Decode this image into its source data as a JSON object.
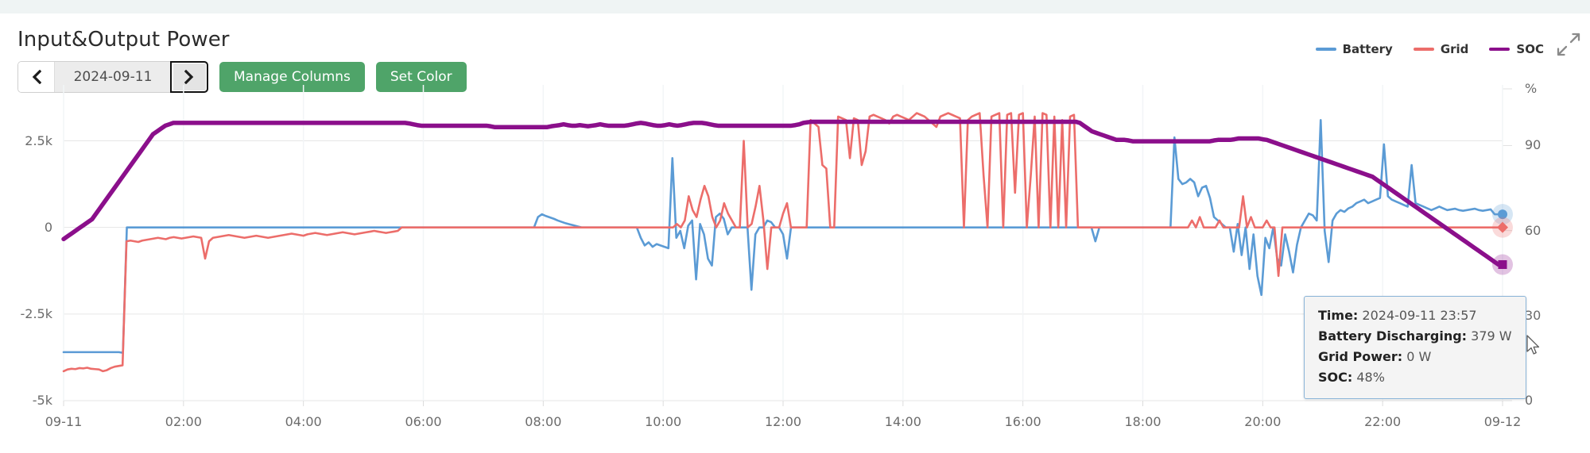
{
  "header": {
    "title": "Input&Output Power"
  },
  "toolbar": {
    "prev_icon": "chevron-left-icon",
    "next_icon": "chevron-right-icon",
    "date_value": "2024-09-11",
    "date_placeholder": "yyyy-mm-dd",
    "manage_columns_label": "Manage Columns",
    "set_color_label": "Set Color",
    "button_color": "#4fa469"
  },
  "expand_icon": "expand-arrows-icon",
  "tooltip": {
    "rows": [
      {
        "key": "Time:",
        "value": "2024-09-11 23:57"
      },
      {
        "key": "Battery Discharging:",
        "value": "379 W"
      },
      {
        "key": "Grid Power:",
        "value": "0 W"
      },
      {
        "key": "SOC:",
        "value": "48%"
      }
    ]
  },
  "chart_data": {
    "type": "line",
    "title": "Input&Output Power",
    "xlabel": "",
    "ylabel": "",
    "y2label": "%",
    "grid": true,
    "legend_position": "top-right",
    "xlim": [
      "09-11 00:00",
      "09-12 00:00"
    ],
    "ylim": [
      -5000,
      4000
    ],
    "y2lim": [
      0,
      110
    ],
    "yticks": [
      -5000,
      -2500,
      0,
      2500
    ],
    "ytick_labels": [
      "-5k",
      "-2.5k",
      "0",
      "2.5k"
    ],
    "y2ticks": [
      0,
      30,
      60,
      90
    ],
    "y2tick_labels": [
      "0",
      "30",
      "60",
      "90"
    ],
    "xticks": [
      "09-11",
      "02:00",
      "04:00",
      "06:00",
      "08:00",
      "10:00",
      "12:00",
      "14:00",
      "16:00",
      "18:00",
      "20:00",
      "22:00",
      "09-12"
    ],
    "colors": {
      "battery": "#5b9bd5",
      "grid": "#ec6d6a",
      "soc": "#8b0f8b"
    },
    "series": [
      {
        "name": "Battery",
        "axis": "left",
        "color": "#5b9bd5",
        "unit": "W",
        "marker_end": "circle",
        "values": [
          -3600,
          -3600,
          -3600,
          -3600,
          -3600,
          -3600,
          -3600,
          -3600,
          -3600,
          -3600,
          -3600,
          -3600,
          -3600,
          -3600,
          -3600,
          -3620,
          0,
          0,
          0,
          0,
          0,
          0,
          0,
          0,
          0,
          0,
          0,
          0,
          0,
          0,
          0,
          0,
          0,
          0,
          0,
          0,
          0,
          0,
          0,
          0,
          0,
          0,
          0,
          0,
          0,
          0,
          0,
          0,
          0,
          0,
          0,
          0,
          0,
          0,
          0,
          0,
          0,
          0,
          0,
          0,
          0,
          0,
          0,
          0,
          0,
          0,
          0,
          0,
          0,
          0,
          0,
          0,
          0,
          0,
          0,
          0,
          0,
          0,
          0,
          0,
          0,
          0,
          0,
          0,
          0,
          0,
          0,
          0,
          0,
          0,
          0,
          0,
          0,
          0,
          0,
          0,
          0,
          0,
          0,
          0,
          0,
          0,
          0,
          0,
          0,
          0,
          0,
          0,
          0,
          0,
          0,
          0,
          0,
          0,
          0,
          0,
          0,
          0,
          0,
          0,
          300,
          380,
          330,
          290,
          250,
          200,
          160,
          120,
          90,
          60,
          30,
          0,
          0,
          0,
          0,
          0,
          0,
          0,
          0,
          0,
          0,
          0,
          0,
          0,
          0,
          0,
          -300,
          -520,
          -430,
          -560,
          -480,
          -520,
          -560,
          -600,
          2000,
          -300,
          -100,
          -600,
          50,
          200,
          -1500,
          100,
          -200,
          -900,
          -1100,
          300,
          400,
          250,
          -200,
          0,
          0,
          0,
          0,
          0,
          -1800,
          -200,
          0,
          0,
          200,
          150,
          0,
          0,
          -200,
          -900,
          0,
          0,
          0,
          0,
          0,
          0,
          0,
          0,
          0,
          0,
          0,
          0,
          0,
          0,
          0,
          0,
          0,
          0,
          0,
          0,
          0,
          0,
          0,
          0,
          0,
          0,
          0,
          0,
          0,
          0,
          0,
          0,
          0,
          0,
          0,
          0,
          0,
          0,
          0,
          0,
          0,
          0,
          0,
          0,
          0,
          0,
          0,
          0,
          0,
          0,
          0,
          0,
          0,
          0,
          0,
          0,
          0,
          0,
          0,
          0,
          0,
          0,
          0,
          0,
          0,
          0,
          0,
          0,
          0,
          0,
          0,
          0,
          0,
          0,
          0,
          0,
          0,
          -400,
          0,
          0,
          0,
          0,
          0,
          0,
          0,
          0,
          0,
          0,
          0,
          0,
          0,
          0,
          0,
          0,
          0,
          0,
          0,
          2600,
          1400,
          1250,
          1300,
          1400,
          1300,
          900,
          1150,
          1200,
          850,
          300,
          200,
          100,
          0,
          0,
          -700,
          100,
          -800,
          0,
          -1200,
          -200,
          -1400,
          -1950,
          -300,
          -600,
          0,
          -900,
          -1100,
          -200,
          -700,
          -1300,
          -500,
          0,
          200,
          400,
          350,
          200,
          3100,
          -100,
          -1000,
          200,
          400,
          500,
          450,
          550,
          600,
          700,
          750,
          800,
          700,
          750,
          800,
          850,
          2400,
          900,
          800,
          750,
          700,
          650,
          600,
          1800,
          700,
          650,
          600,
          550,
          500,
          550,
          600,
          550,
          500,
          520,
          540,
          500,
          480,
          500,
          520,
          540,
          500,
          480,
          500,
          520,
          379,
          379,
          379
        ]
      },
      {
        "name": "Grid",
        "axis": "left",
        "color": "#ec6d6a",
        "unit": "W",
        "marker_end": "diamond",
        "values": [
          -4150,
          -4100,
          -4080,
          -4090,
          -4060,
          -4070,
          -4050,
          -4080,
          -4090,
          -4100,
          -4150,
          -4120,
          -4060,
          -4020,
          -4000,
          -3980,
          -400,
          -380,
          -400,
          -420,
          -380,
          -360,
          -340,
          -320,
          -300,
          -320,
          -340,
          -300,
          -280,
          -300,
          -320,
          -300,
          -280,
          -260,
          -280,
          -300,
          -900,
          -400,
          -300,
          -280,
          -260,
          -240,
          -220,
          -240,
          -260,
          -280,
          -300,
          -280,
          -260,
          -240,
          -260,
          -280,
          -300,
          -280,
          -260,
          -240,
          -220,
          -200,
          -180,
          -200,
          -220,
          -240,
          -200,
          -180,
          -160,
          -180,
          -200,
          -220,
          -200,
          -180,
          -160,
          -140,
          -160,
          -180,
          -200,
          -180,
          -160,
          -140,
          -120,
          -100,
          -120,
          -140,
          -160,
          -140,
          -120,
          -100,
          0,
          0,
          0,
          0,
          0,
          0,
          0,
          0,
          0,
          0,
          0,
          0,
          0,
          0,
          0,
          0,
          0,
          0,
          0,
          0,
          0,
          0,
          0,
          0,
          0,
          0,
          0,
          0,
          0,
          0,
          0,
          0,
          0,
          0,
          0,
          0,
          0,
          0,
          0,
          0,
          0,
          0,
          0,
          0,
          0,
          0,
          0,
          0,
          0,
          0,
          0,
          0,
          0,
          0,
          0,
          0,
          0,
          0,
          0,
          0,
          0,
          0,
          0,
          0,
          0,
          0,
          0,
          0,
          0,
          0,
          100,
          0,
          200,
          900,
          500,
          300,
          800,
          1200,
          900,
          300,
          0,
          200,
          700,
          400,
          200,
          0,
          0,
          2500,
          0,
          100,
          600,
          1200,
          200,
          -1200,
          0,
          0,
          0,
          400,
          700,
          0,
          0,
          0,
          0,
          0,
          3100,
          3000,
          2900,
          1800,
          1700,
          0,
          0,
          3200,
          3150,
          3100,
          2000,
          3150,
          3100,
          1800,
          2200,
          3200,
          3250,
          3200,
          3150,
          3100,
          3000,
          3200,
          3250,
          3200,
          3150,
          3100,
          3200,
          3300,
          3250,
          3200,
          3100,
          3000,
          2900,
          3200,
          3250,
          3300,
          3250,
          3200,
          3150,
          0,
          3100,
          3200,
          3250,
          3300,
          1500,
          0,
          3200,
          3250,
          3300,
          0,
          3250,
          3300,
          1000,
          3250,
          3300,
          0,
          1500,
          3200,
          0,
          3300,
          3250,
          0,
          3200,
          0,
          3100,
          0,
          3200,
          3250,
          0,
          0,
          0,
          0,
          0,
          0,
          0,
          0,
          0,
          0,
          0,
          0,
          0,
          0,
          0,
          0,
          0,
          0,
          0,
          0,
          0,
          0,
          0,
          0,
          0,
          0,
          0,
          0,
          0,
          200,
          0,
          300,
          0,
          0,
          0,
          0,
          200,
          0,
          0,
          0,
          0,
          0,
          900,
          0,
          300,
          0,
          0,
          0,
          200,
          0,
          0,
          -1400,
          0,
          0,
          0,
          0,
          0,
          0,
          0,
          0,
          0,
          0,
          0,
          0,
          0,
          0,
          0,
          0,
          0,
          0,
          0,
          0,
          0,
          0,
          0,
          0,
          0,
          0,
          0,
          0,
          0,
          0,
          0,
          0,
          0,
          0,
          0,
          0,
          0,
          0,
          0,
          0,
          0,
          0,
          0,
          0,
          0,
          0,
          0,
          0,
          0,
          0,
          0,
          0,
          0,
          0,
          0,
          0,
          0
        ]
      },
      {
        "name": "SOC",
        "axis": "right",
        "color": "#8b0f8b",
        "unit": "%",
        "marker_end": "square",
        "values": [
          57,
          58,
          59,
          60,
          61,
          62,
          63,
          64,
          66,
          68,
          70,
          72,
          74,
          76,
          78,
          80,
          82,
          84,
          86,
          88,
          90,
          92,
          94,
          95,
          96,
          97,
          97.5,
          98,
          98,
          98,
          98,
          98,
          98,
          98,
          98,
          98,
          98,
          98,
          98,
          98,
          98,
          98,
          98,
          98,
          98,
          98,
          98,
          98,
          98,
          98,
          98,
          98,
          98,
          98,
          98,
          98,
          98,
          98,
          98,
          98,
          98,
          98,
          98,
          98,
          98,
          98,
          98,
          98,
          98,
          98,
          98,
          98,
          98,
          98,
          98,
          98,
          98,
          98,
          98,
          98,
          98,
          98,
          98,
          98,
          98,
          97.8,
          97.5,
          97.2,
          97,
          97,
          97,
          97,
          97,
          97,
          97,
          97,
          97,
          97,
          97,
          97,
          97,
          97,
          97,
          97,
          97,
          96.8,
          96.5,
          96.5,
          96.5,
          96.5,
          96.5,
          96.5,
          96.5,
          96.5,
          96.5,
          96.5,
          96.5,
          96.5,
          96.5,
          96.5,
          96.8,
          97,
          97.2,
          97.5,
          97.2,
          97,
          97,
          97.2,
          97,
          96.8,
          97,
          97.2,
          97.5,
          97.2,
          97,
          97,
          97,
          97,
          97,
          97.2,
          97.5,
          97.8,
          98,
          97.8,
          97.5,
          97.2,
          97,
          97,
          97.2,
          97.5,
          97.2,
          97,
          97.2,
          97.5,
          97.8,
          98,
          98,
          98,
          97.8,
          97.5,
          97.2,
          97,
          97,
          97,
          97,
          97,
          97,
          97,
          97,
          97,
          97,
          97,
          97,
          97,
          97,
          97,
          97,
          97,
          97,
          97,
          97.2,
          97.5,
          98,
          98.2,
          98.4,
          98.4,
          98.4,
          98.4,
          98.4,
          98.4,
          98.4,
          98.4,
          98.4,
          98.4,
          98.4,
          98.4,
          98.4,
          98.4,
          98.4,
          98.4,
          98.4,
          98.4,
          98.4,
          98.4,
          98.4,
          98.4,
          98.4,
          98.4,
          98.4,
          98.4,
          98.4,
          98.4,
          98.4,
          98.4,
          98.4,
          98.4,
          98.4,
          98.4,
          98.4,
          98.4,
          98.4,
          98.4,
          98.4,
          98.4,
          98.4,
          98.4,
          98.4,
          98.4,
          98.4,
          98.4,
          98.4,
          98.4,
          98.4,
          98.4,
          98.4,
          98.4,
          98.4,
          98.4,
          98.4,
          98.4,
          98.4,
          98.4,
          98.4,
          98.4,
          98.4,
          98.4,
          98.4,
          98.4,
          98.4,
          98.4,
          98,
          97,
          96,
          95,
          94.5,
          94,
          93.5,
          93,
          92.5,
          92,
          92,
          92,
          91.8,
          91.5,
          91.5,
          91.5,
          91.5,
          91.5,
          91.5,
          91.5,
          91.5,
          91.5,
          91.5,
          91.5,
          91.5,
          91.5,
          91.5,
          91.5,
          91.5,
          91.5,
          91.5,
          91.5,
          91.5,
          91.8,
          92,
          92,
          92,
          92,
          92.2,
          92.5,
          92.5,
          92.5,
          92.5,
          92.5,
          92.5,
          92.2,
          92,
          91.5,
          91,
          90.5,
          90,
          89.5,
          89,
          88.5,
          88,
          87.5,
          87,
          86.5,
          86,
          85.5,
          85,
          84.5,
          84,
          83.5,
          83,
          82.5,
          82,
          81.5,
          81,
          80.5,
          80,
          79.5,
          79,
          78,
          77,
          76,
          75,
          74,
          73,
          72,
          71,
          70,
          69,
          68,
          67,
          66,
          65,
          64,
          63,
          62,
          61,
          60,
          59,
          58,
          57,
          56,
          55,
          54,
          53,
          52,
          51,
          50,
          49,
          48,
          48
        ]
      }
    ],
    "annotations": {
      "hover_time": "2024-09-11 23:57",
      "hover_battery": "379 W",
      "hover_grid": "0 W",
      "hover_soc": "48%"
    }
  }
}
